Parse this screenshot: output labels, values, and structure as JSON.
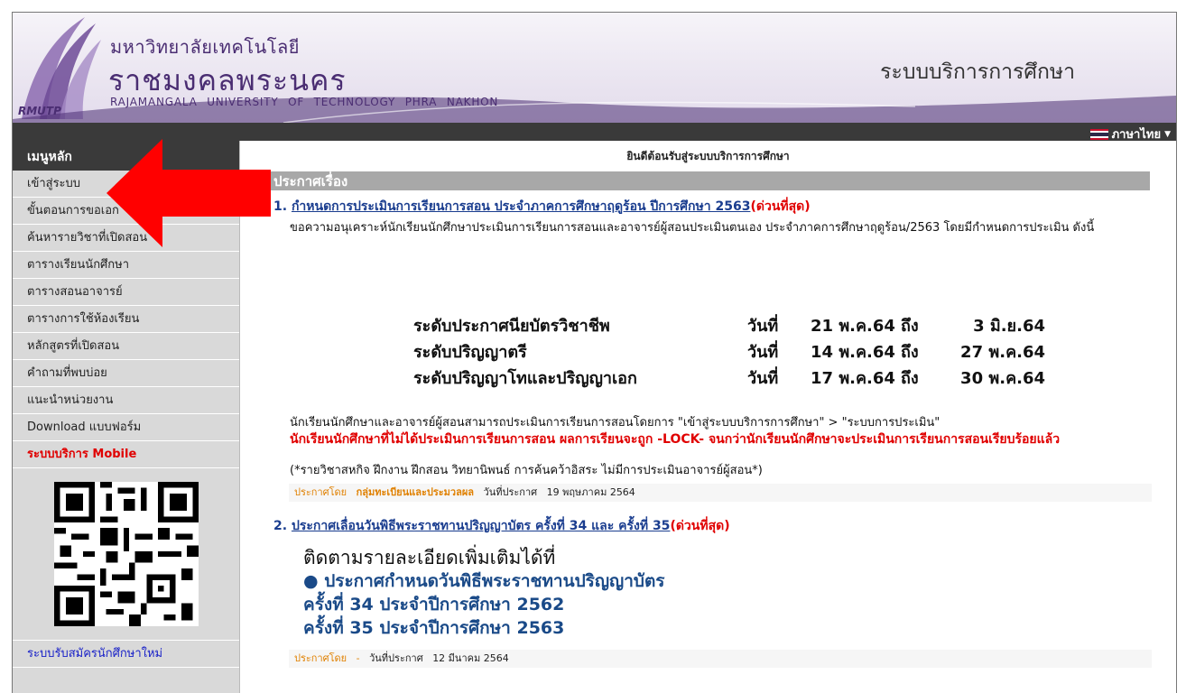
{
  "header": {
    "uni_name_th_line1": "มหาวิทยาลัยเทคโนโลยี",
    "uni_name_th_line2": "ราชมงคลพระนคร",
    "uni_name_en": "RAJAMANGALA UNIVERSITY  OF TECHNOLOGY PHRA NAKHON",
    "logo_abbr": "RMUTP",
    "system_title": "ระบบบริการการศึกษา",
    "language": "ภาษาไทย"
  },
  "sidebar": {
    "heading": "เมนูหลัก",
    "items": [
      "เข้าสู่ระบบ",
      "ขั้นตอนการขอเอก",
      "ค้นหารายวิชาที่เปิดสอน",
      "ตารางเรียนนักศึกษา",
      "ตารางสอนอาจารย์",
      "ตารางการใช้ห้องเรียน",
      "หลักสูตรที่เปิดสอน",
      "คำถามที่พบบ่อย",
      "แนะนำหน่วยงาน",
      "Download แบบฟอร์ม"
    ],
    "mobile_label": "ระบบบริการ Mobile",
    "apply_label": "ระบบรับสมัครนักศึกษาใหม่"
  },
  "main": {
    "welcome": "ยินดีต้อนรับสู่ระบบบริการการศึกษา",
    "announce_heading": "ประกาศเรื่อง",
    "announcements": [
      {
        "num": "1.",
        "title": "กำหนดการประเมินการเรียนการสอน ประจำภาคการศึกษาฤดูร้อน ปีการศึกษา 2563",
        "urgent": "(ด่วนที่สุด)",
        "intro": "ขอความอนุเคราะห์นักเรียนนักศึกษาประเมินการเรียนการสอนและอาจารย์ผู้สอนประเมินตนเอง ประจำภาคการศึกษาฤดูร้อน/2563 โดยมีกำหนดการประเมิน ดังนี้",
        "schedule": [
          {
            "level": "ระดับประกาศนียบัตรวิชาชีพ",
            "day": "วันที่",
            "start": "21 พ.ค.64",
            "to": "ถึง",
            "end": "3 มิ.ย.64"
          },
          {
            "level": "ระดับปริญญาตรี",
            "day": "วันที่",
            "start": "14 พ.ค.64",
            "to": "ถึง",
            "end": "27 พ.ค.64"
          },
          {
            "level": "ระดับปริญญาโทและปริญญาเอก",
            "day": "วันที่",
            "start": "17 พ.ค.64",
            "to": "ถึง",
            "end": "30 พ.ค.64"
          }
        ],
        "how_to": "นักเรียนนักศึกษาและอาจารย์ผู้สอนสามารถประเมินการเรียนการสอนโดยการ \"เข้าสู่ระบบบริการการศึกษา\" > \"ระบบการประเมิน\"",
        "warning": "นักเรียนนักศึกษาที่ไม่ได้ประเมินการเรียนการสอน ผลการเรียนจะถูก -LOCK- จนกว่านักเรียนนักศึกษาจะประเมินการเรียนการสอนเรียบร้อยแล้ว",
        "note": "(*รายวิชาสหกิจ ฝึกงาน ฝึกสอน วิทยานิพนธ์ การค้นคว้าอิสระ ไม่มีการประเมินอาจารย์ผู้สอน*)",
        "posted_by_label": "ประกาศโดย",
        "posted_by": "กลุ่มทะเบียนและประมวลผล",
        "date_label": "วันที่ประกาศ",
        "date": "19 พฤษภาคม 2564"
      },
      {
        "num": "2.",
        "title": "ประกาศเลื่อนวันพิธีพระราชทานปริญญาบัตร ครั้งที่ 34 และ ครั้งที่ 35",
        "urgent": "(ด่วนที่สุด)",
        "follow": "ติดตามรายละเอียดเพิ่มเติมได้ที่",
        "line1": "● ประกาศกำหนดวันพิธีพระราชทานปริญญาบัตร",
        "line2": "ครั้งที่ 34 ประจำปีการศึกษา 2562",
        "line3": "ครั้งที่ 35 ประจำปีการศึกษา 2563",
        "posted_by_label": "ประกาศโดย",
        "posted_by": "-",
        "date_label": "วันที่ประกาศ",
        "date": "12 มีนาคม 2564"
      }
    ]
  },
  "colors": {
    "urgent": "#e00000",
    "link": "#1a3d8f",
    "sidebar_bg": "#d9d9d9",
    "bar_dark": "#3a3a3a",
    "arrow": "#ff0000"
  }
}
